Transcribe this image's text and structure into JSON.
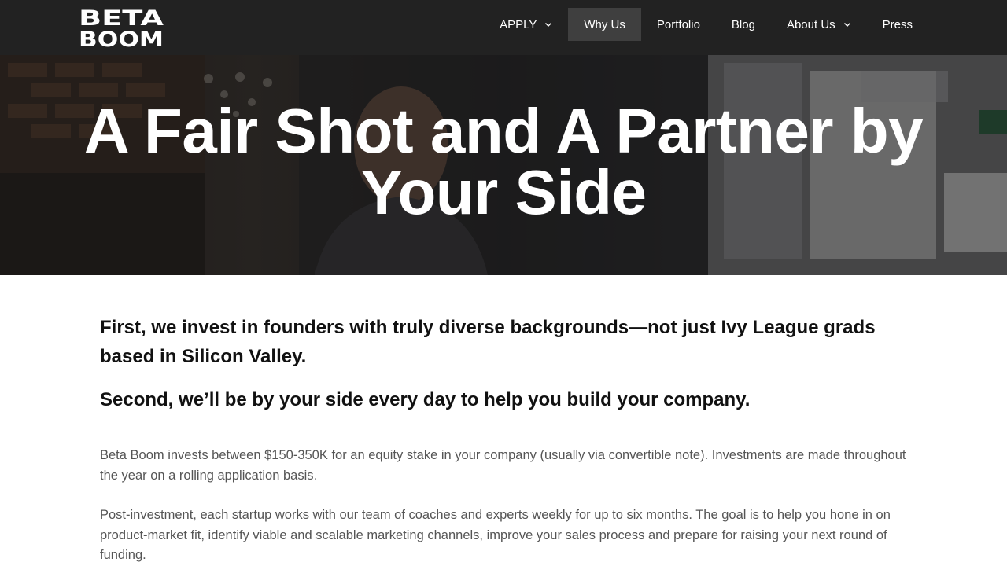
{
  "brand": {
    "logo_line1": "BETA",
    "logo_line2": "BOOM"
  },
  "nav": {
    "items": [
      {
        "label": "APPLY",
        "has_dropdown": true
      },
      {
        "label": "Why Us",
        "active": true
      },
      {
        "label": "Portfolio"
      },
      {
        "label": "Blog"
      },
      {
        "label": "About Us",
        "has_dropdown": true
      },
      {
        "label": "Press"
      }
    ]
  },
  "hero": {
    "title": "A Fair Shot and A Partner by Your Side"
  },
  "content": {
    "lead1": "First, we invest in founders with truly diverse backgrounds—not just Ivy League grads based in Silicon Valley.",
    "lead2": "Second, we’ll be by your side every day to help you build your company.",
    "para1": "Beta Boom invests between $150-350K for an equity stake in your company (usually via convertible note). Investments are made throughout the year on a rolling application basis.",
    "para2": "Post-investment, each startup works with our team of coaches and experts weekly for up to six months. The goal is to help you hone in on product-market fit, identify viable and scalable marketing channels, improve your sales process and prepare for raising your next round of funding."
  },
  "colors": {
    "topbar_bg": "#222222",
    "active_nav_bg": "#3f3f3f",
    "hero_text": "#ffffff",
    "lead_text": "#111111",
    "body_text": "#555555"
  }
}
